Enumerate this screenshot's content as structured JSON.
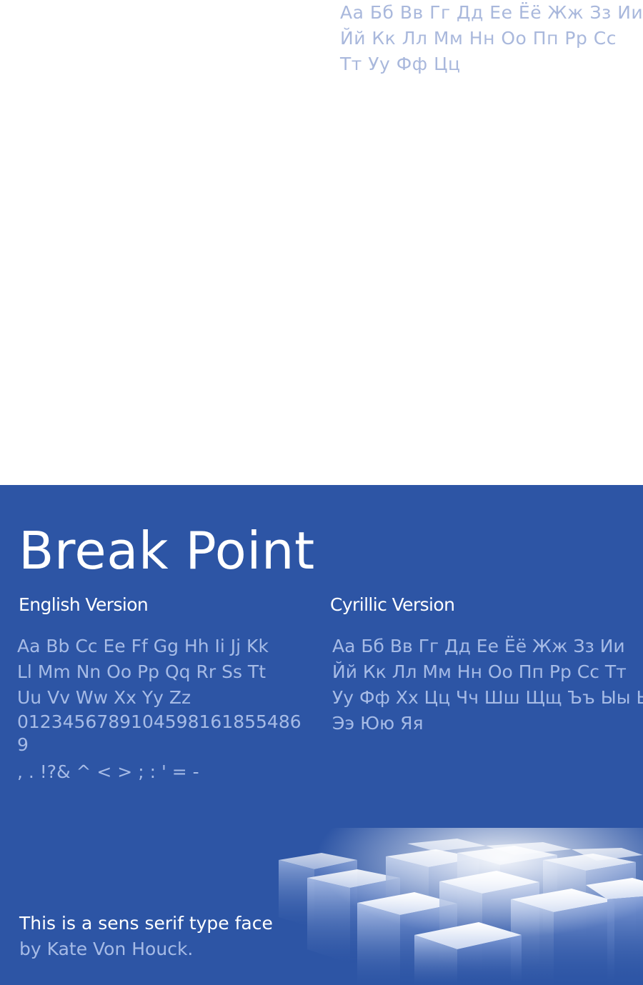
{
  "top_cyrillic": {
    "lines": [
      "Аа Бб Вв Гг Дд Ее Ёё Жж Зз Ии",
      "Йй Кк Лл Мм Нн Оо Пп Рр Сс",
      "Тт Уу Фф Цц"
    ]
  },
  "poster": {
    "title": "Break Point",
    "english": {
      "heading": "English Version",
      "lines": [
        "Aa Bb Cc Ee Ff Gg Hh Ii Jj Kk",
        "Ll Mm Nn Oo Pp Qq Rr Ss Tt",
        "Uu Vv Ww Xx Yy Zz",
        "012345678910459816185548­69",
        ", . !?& ^ < > ; : ' = -"
      ]
    },
    "cyrillic": {
      "heading": "Cyrillic Version",
      "lines": [
        "Аа Бб Вв Гг Дд Ее Ёё Жж Зз Ии",
        "Йй Кк Лл Мм Нн Оо Пп Рр Сс Тт",
        "Уу Фф Хх Цц Чч Шш Щщ Ъъ Ыы Ьь",
        "Ээ Юю Яя"
      ]
    },
    "tagline": {
      "line1": "This is a sens serif type face",
      "line2": "by Kate Von Houck."
    }
  },
  "colors": {
    "panel": "#2d55a5",
    "light_text": "#a6bbe6",
    "top_text": "#a9b8dc",
    "white": "#ffffff"
  }
}
